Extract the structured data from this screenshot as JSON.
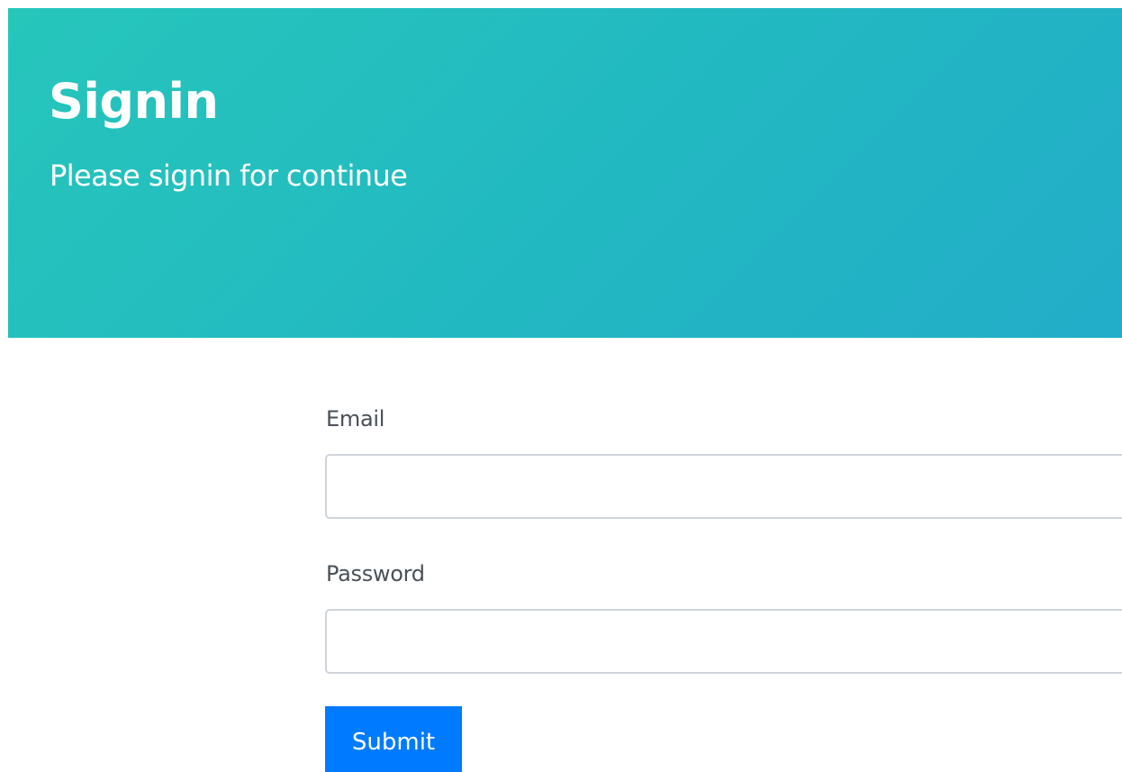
{
  "hero": {
    "title": "Signin",
    "subtitle": "Please signin for continue",
    "gradient_start": "#26c6bb",
    "gradient_end": "#22adc8"
  },
  "form": {
    "email": {
      "label": "Email",
      "value": "",
      "placeholder": ""
    },
    "password": {
      "label": "Password",
      "value": "",
      "placeholder": ""
    },
    "submit_label": "Submit",
    "submit_color": "#007bff"
  }
}
